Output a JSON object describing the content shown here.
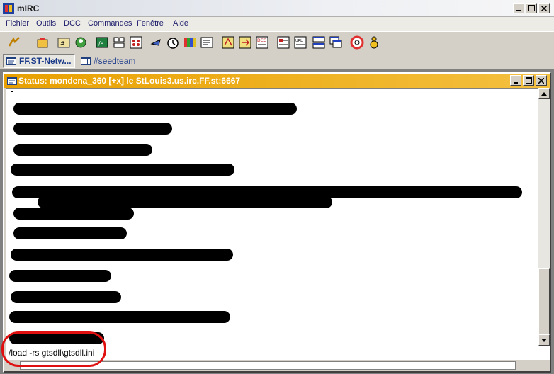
{
  "app": {
    "title": "mIRC",
    "icon": "mirc-app-icon"
  },
  "window_controls": [
    "minimize-icon",
    "maximize-icon",
    "close-icon"
  ],
  "menubar": {
    "items": [
      "Fichier",
      "Outils",
      "DCC",
      "Commandes",
      "Fenêtre",
      "Aide"
    ]
  },
  "toolbar": {
    "buttons": [
      "connect-icon",
      "options-icon",
      "channels-list-icon",
      "address-book-icon",
      "remote-icon",
      "aliases-icon",
      "popups-icon",
      "send-icon",
      "timer-icon",
      "colors-icon",
      "notify-icon",
      "log-icon",
      "dcc-send-icon",
      "dcc-chat-icon",
      "dcc-options-icon",
      "tile-icon",
      "cascade-icon",
      "help-icon",
      "about-icon"
    ]
  },
  "switchbar": {
    "tabs": [
      {
        "label": "FF.ST-Netw...",
        "icon": "status-window-icon",
        "active": true
      },
      {
        "label": "#seedteam",
        "icon": "channel-window-icon",
        "active": false
      }
    ]
  },
  "status_window": {
    "title": "Status: mondena_360 [+x] le StLouis3.us.irc.FF.st:6667",
    "input_value": "/load -rs gtsdll\\gtsdll.ini",
    "redacted_lines": 15
  },
  "colors": {
    "title_active": "#e8a000",
    "highlight_circle": "#e01010",
    "menu_text": "#1a1a6a"
  }
}
